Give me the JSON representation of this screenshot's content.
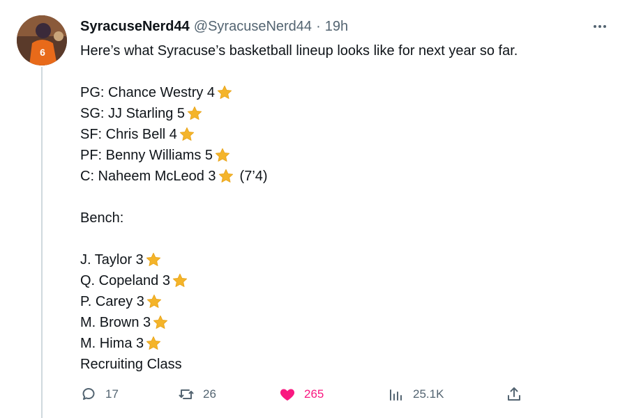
{
  "tweet": {
    "display_name": "SyracuseNerd44",
    "handle": "@SyracuseNerd44",
    "separator": "·",
    "timestamp": "19h",
    "lines": [
      {
        "text": "Here’s what Syracuse’s basketball lineup looks like for next year so far.",
        "star": false,
        "extra": ""
      },
      {
        "text": "",
        "star": false,
        "extra": ""
      },
      {
        "text": "PG: Chance Westry 4",
        "star": true,
        "extra": ""
      },
      {
        "text": "SG: JJ Starling 5",
        "star": true,
        "extra": ""
      },
      {
        "text": "SF: Chris Bell 4",
        "star": true,
        "extra": ""
      },
      {
        "text": "PF: Benny Williams 5",
        "star": true,
        "extra": ""
      },
      {
        "text": "C: Naheem McLeod 3",
        "star": true,
        "extra": "(7’4)"
      },
      {
        "text": "",
        "star": false,
        "extra": ""
      },
      {
        "text": "Bench:",
        "star": false,
        "extra": ""
      },
      {
        "text": "",
        "star": false,
        "extra": ""
      },
      {
        "text": "J. Taylor 3",
        "star": true,
        "extra": ""
      },
      {
        "text": "Q. Copeland 3",
        "star": true,
        "extra": ""
      },
      {
        "text": "P. Carey 3",
        "star": true,
        "extra": ""
      },
      {
        "text": "M. Brown 3",
        "star": true,
        "extra": ""
      },
      {
        "text": "M. Hima 3",
        "star": true,
        "extra": ""
      },
      {
        "text": "Recruiting Class",
        "star": false,
        "extra": ""
      }
    ],
    "star_icon": "star-emoji-icon",
    "star_color": "#f4b42a"
  },
  "actions": {
    "reply": {
      "icon": "reply-icon",
      "count": "17"
    },
    "retweet": {
      "icon": "retweet-icon",
      "count": "26"
    },
    "like": {
      "icon": "heart-filled-icon",
      "count": "265",
      "liked": true,
      "color": "#f91880"
    },
    "views": {
      "icon": "views-icon",
      "count": "25.1K"
    },
    "share": {
      "icon": "share-icon"
    }
  },
  "colors": {
    "text": "#0f1419",
    "secondary": "#536471",
    "thread_line": "#cfd9de"
  }
}
